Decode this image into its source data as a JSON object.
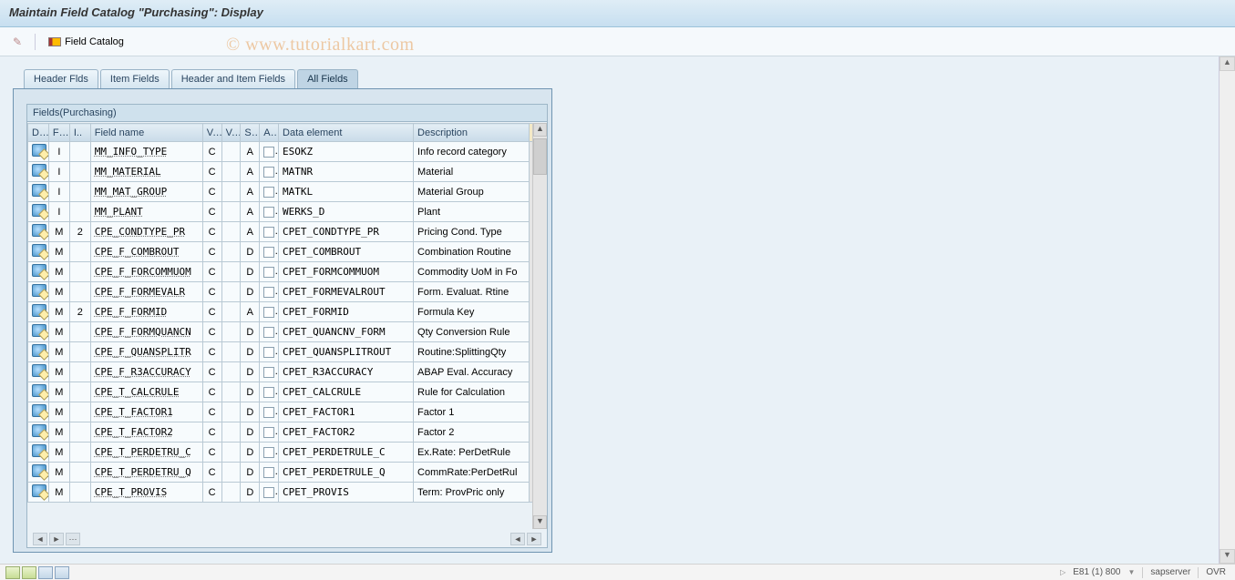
{
  "title": "Maintain Field Catalog \"Purchasing\": Display",
  "toolbar": {
    "field_catalog_label": "Field Catalog"
  },
  "watermark": "© www.tutorialkart.com",
  "tabs": [
    {
      "label": "Header Flds",
      "active": false
    },
    {
      "label": "Item Fields",
      "active": false
    },
    {
      "label": "Header and Item Fields",
      "active": false
    },
    {
      "label": "All Fields",
      "active": true
    }
  ],
  "group_title": "Fields(Purchasing)",
  "columns": {
    "c_details": "D..",
    "c_fi": "Fi..",
    "c_i": "I..",
    "c_fieldname": "Field name",
    "c_v": "V..",
    "c_v2": "V..",
    "c_s": "S..",
    "c_a": "A..",
    "c_dataelem": "Data element",
    "c_desc": "Description"
  },
  "rows": [
    {
      "fi": "I",
      "i": "",
      "field": "MM_INFO_TYPE",
      "v": "C",
      "a": "A",
      "elem": "ESOKZ",
      "desc": "Info record category"
    },
    {
      "fi": "I",
      "i": "",
      "field": "MM_MATERIAL",
      "v": "C",
      "a": "A",
      "elem": "MATNR",
      "desc": "Material"
    },
    {
      "fi": "I",
      "i": "",
      "field": "MM_MAT_GROUP",
      "v": "C",
      "a": "A",
      "elem": "MATKL",
      "desc": "Material Group"
    },
    {
      "fi": "I",
      "i": "",
      "field": "MM_PLANT",
      "v": "C",
      "a": "A",
      "elem": "WERKS_D",
      "desc": "Plant"
    },
    {
      "fi": "M",
      "i": "2",
      "field": "CPE_CONDTYPE_PR",
      "v": "C",
      "a": "A",
      "elem": "CPET_CONDTYPE_PR",
      "desc": "Pricing Cond. Type"
    },
    {
      "fi": "M",
      "i": "",
      "field": "CPE_F_COMBROUT",
      "v": "C",
      "a": "D",
      "elem": "CPET_COMBROUT",
      "desc": "Combination Routine"
    },
    {
      "fi": "M",
      "i": "",
      "field": "CPE_F_FORCOMMUOM",
      "v": "C",
      "a": "D",
      "elem": "CPET_FORMCOMMUOM",
      "desc": "Commodity UoM in Fo"
    },
    {
      "fi": "M",
      "i": "",
      "field": "CPE_F_FORMEVALR",
      "v": "C",
      "a": "D",
      "elem": "CPET_FORMEVALROUT",
      "desc": "Form. Evaluat. Rtine"
    },
    {
      "fi": "M",
      "i": "2",
      "field": "CPE_F_FORMID",
      "v": "C",
      "a": "A",
      "elem": "CPET_FORMID",
      "desc": "Formula Key"
    },
    {
      "fi": "M",
      "i": "",
      "field": "CPE_F_FORMQUANCN",
      "v": "C",
      "a": "D",
      "elem": "CPET_QUANCNV_FORM",
      "desc": "Qty Conversion Rule"
    },
    {
      "fi": "M",
      "i": "",
      "field": "CPE_F_QUANSPLITR",
      "v": "C",
      "a": "D",
      "elem": "CPET_QUANSPLITROUT",
      "desc": "Routine:SplittingQty"
    },
    {
      "fi": "M",
      "i": "",
      "field": "CPE_F_R3ACCURACY",
      "v": "C",
      "a": "D",
      "elem": "CPET_R3ACCURACY",
      "desc": "ABAP Eval. Accuracy"
    },
    {
      "fi": "M",
      "i": "",
      "field": "CPE_T_CALCRULE",
      "v": "C",
      "a": "D",
      "elem": "CPET_CALCRULE",
      "desc": "Rule for Calculation"
    },
    {
      "fi": "M",
      "i": "",
      "field": "CPE_T_FACTOR1",
      "v": "C",
      "a": "D",
      "elem": "CPET_FACTOR1",
      "desc": "Factor 1"
    },
    {
      "fi": "M",
      "i": "",
      "field": "CPE_T_FACTOR2",
      "v": "C",
      "a": "D",
      "elem": "CPET_FACTOR2",
      "desc": "Factor 2"
    },
    {
      "fi": "M",
      "i": "",
      "field": "CPE_T_PERDETRU_C",
      "v": "C",
      "a": "D",
      "elem": "CPET_PERDETRULE_C",
      "desc": "Ex.Rate: PerDetRule"
    },
    {
      "fi": "M",
      "i": "",
      "field": "CPE_T_PERDETRU_Q",
      "v": "C",
      "a": "D",
      "elem": "CPET_PERDETRULE_Q",
      "desc": "CommRate:PerDetRul"
    },
    {
      "fi": "M",
      "i": "",
      "field": "CPE_T_PROVIS",
      "v": "C",
      "a": "D",
      "elem": "CPET_PROVIS",
      "desc": "Term: ProvPric only"
    }
  ],
  "status": {
    "session": "E81 (1) 800",
    "server": "sapserver",
    "mode": "OVR"
  }
}
